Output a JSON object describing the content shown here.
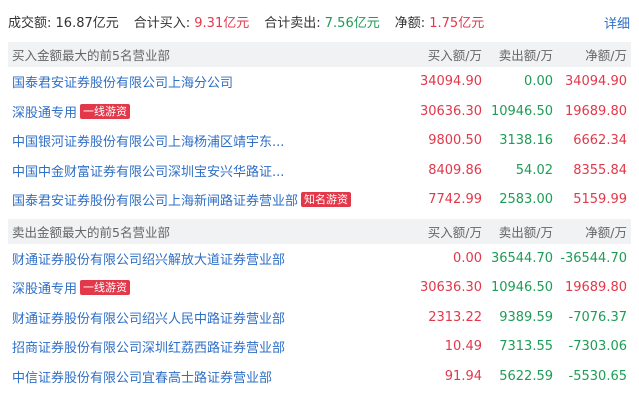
{
  "summary": {
    "turnover_label": "成交额:",
    "turnover_value": "16.87亿元",
    "buy_label": "合计买入:",
    "buy_value": "9.31亿元",
    "sell_label": "合计卖出:",
    "sell_value": "7.56亿元",
    "net_label": "净额:",
    "net_value": "1.75亿元",
    "detail_link": "详细"
  },
  "buy_section": {
    "title": "买入金额最大的前5名营业部",
    "col_buy": "买入额/万",
    "col_sell": "卖出额/万",
    "col_net": "净额/万",
    "rows": [
      {
        "name": "国泰君安证券股份有限公司上海分公司",
        "tag": "",
        "buy": "34094.90",
        "sell": "0.00",
        "net": "34094.90"
      },
      {
        "name": "深股通专用",
        "tag": "一线游资",
        "buy": "30636.30",
        "sell": "10946.50",
        "net": "19689.80"
      },
      {
        "name": "中国银河证券股份有限公司上海杨浦区靖宇东...",
        "tag": "",
        "buy": "9800.50",
        "sell": "3138.16",
        "net": "6662.34"
      },
      {
        "name": "中国中金财富证券有限公司深圳宝安兴华路证...",
        "tag": "",
        "buy": "8409.86",
        "sell": "54.02",
        "net": "8355.84"
      },
      {
        "name": "国泰君安证券股份有限公司上海新闸路证券营业部",
        "tag": "知名游资",
        "buy": "7742.99",
        "sell": "2583.00",
        "net": "5159.99"
      }
    ]
  },
  "sell_section": {
    "title": "卖出金额最大的前5名营业部",
    "col_buy": "买入额/万",
    "col_sell": "卖出额/万",
    "col_net": "净额/万",
    "rows": [
      {
        "name": "财通证券股份有限公司绍兴解放大道证券营业部",
        "tag": "",
        "buy": "0.00",
        "sell": "36544.70",
        "net": "-36544.70"
      },
      {
        "name": "深股通专用",
        "tag": "一线游资",
        "buy": "30636.30",
        "sell": "10946.50",
        "net": "19689.80"
      },
      {
        "name": "财通证券股份有限公司绍兴人民中路证券营业部",
        "tag": "",
        "buy": "2313.22",
        "sell": "9389.59",
        "net": "-7076.37"
      },
      {
        "name": "招商证券股份有限公司深圳红荔西路证券营业部",
        "tag": "",
        "buy": "10.49",
        "sell": "7313.55",
        "net": "-7303.06"
      },
      {
        "name": "中信证券股份有限公司宜春高士路证券营业部",
        "tag": "",
        "buy": "91.94",
        "sell": "5622.59",
        "net": "-5530.65"
      }
    ]
  },
  "colors": {
    "red": "#e2384a",
    "green": "#1e9c56",
    "link": "#2f6fc6",
    "header_bg": "#f1f2f4"
  }
}
